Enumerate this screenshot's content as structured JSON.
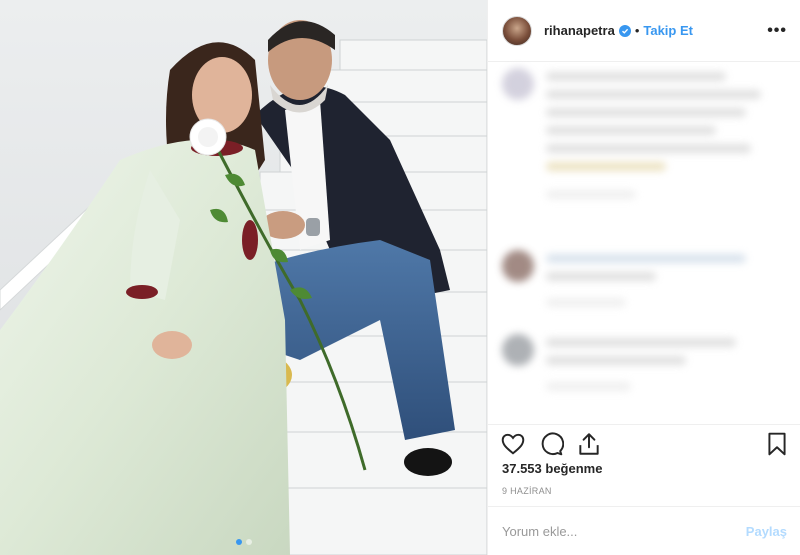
{
  "post": {
    "photo_alt": "Couple seated on white staircase, woman in pale green dress holding a white rose",
    "carousel_dot_count": 2,
    "carousel_active_index": 0
  },
  "header": {
    "username": "rihanapetra",
    "verified_icon": "verified-badge-icon",
    "separator": "•",
    "follow_label": "Takip Et",
    "more_icon": "more-options-icon",
    "more_glyph": "•••"
  },
  "comments": {
    "blurred": true
  },
  "actions": {
    "like_icon": "heart-icon",
    "comment_icon": "comment-icon",
    "share_icon": "share-icon",
    "save_icon": "bookmark-icon"
  },
  "likes_text": "37.553 beğenme",
  "date_text": "9 HAZİRAN",
  "composer": {
    "placeholder": "Yorum ekle...",
    "post_label": "Paylaş"
  },
  "colors": {
    "accent": "#3897f0",
    "post_disabled": "#b3dbff",
    "text": "#262626",
    "muted": "#8e8e8e"
  }
}
